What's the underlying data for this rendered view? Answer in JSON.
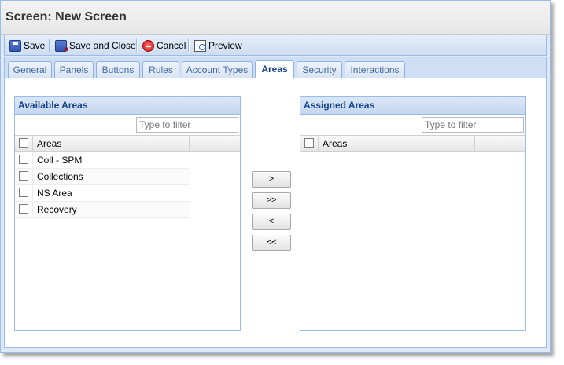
{
  "window": {
    "title": "Screen: New Screen"
  },
  "toolbar": {
    "save_label": "Save",
    "save_close_label": "Save and Close",
    "cancel_label": "Cancel",
    "preview_label": "Preview"
  },
  "tabs": [
    {
      "label": "General"
    },
    {
      "label": "Panels"
    },
    {
      "label": "Buttons"
    },
    {
      "label": "Rules"
    },
    {
      "label": "Account Types"
    },
    {
      "label": "Areas",
      "active": true
    },
    {
      "label": "Security"
    },
    {
      "label": "Interactions"
    }
  ],
  "available": {
    "title": "Available Areas",
    "filter_placeholder": "Type to filter",
    "column": "Areas",
    "rows": [
      "Coll - SPM",
      "Collections",
      "NS Area",
      "Recovery"
    ]
  },
  "assigned": {
    "title": "Assigned Areas",
    "filter_placeholder": "Type to filter",
    "column": "Areas",
    "rows": []
  },
  "move_buttons": {
    "add": ">",
    "add_all": ">>",
    "remove": "<",
    "remove_all": "<<"
  },
  "colors": {
    "panel_header": "#c5d7ef",
    "border": "#99bbe8",
    "title_text": "#15428b"
  }
}
